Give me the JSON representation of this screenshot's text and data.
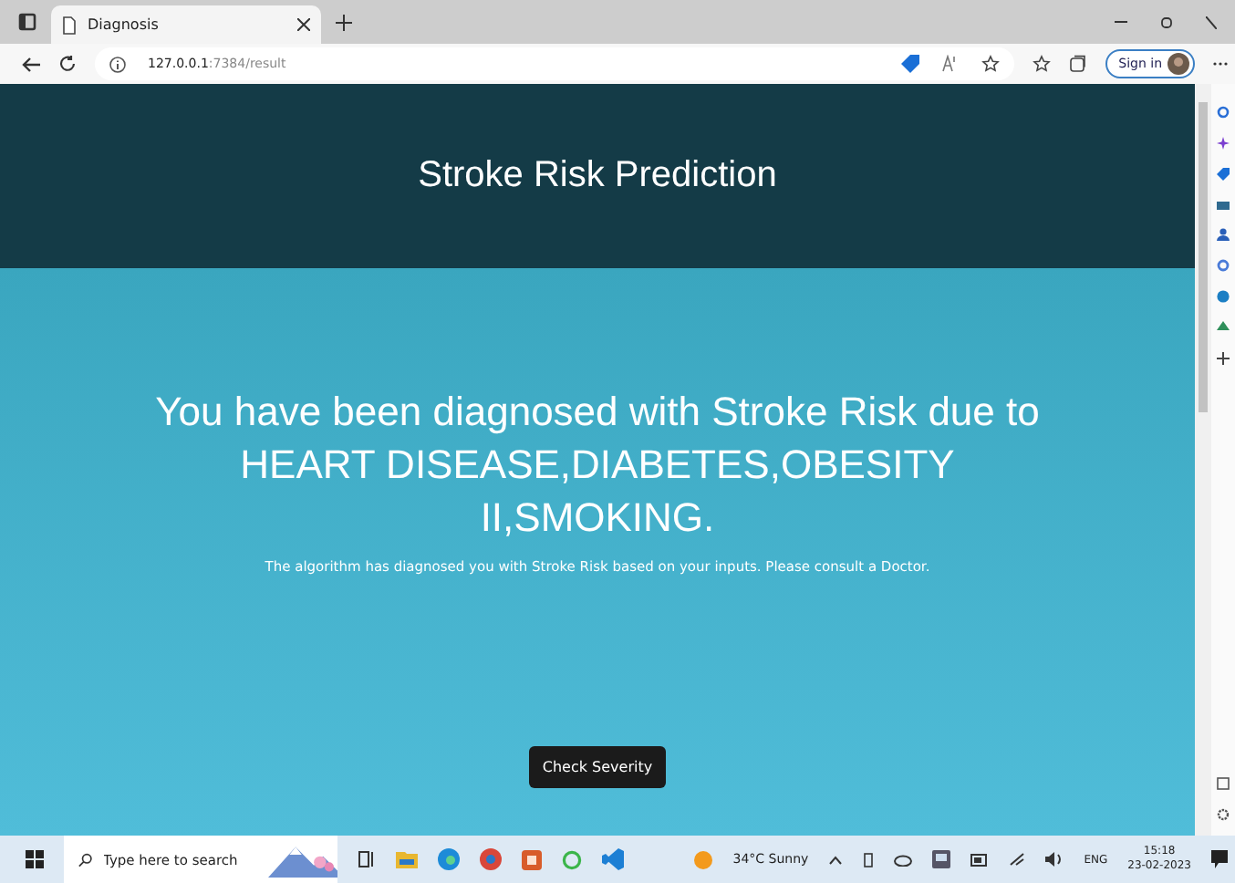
{
  "browser": {
    "tab_title": "Diagnosis",
    "url_host": "127.0.0.1",
    "url_rest": ":7384/result",
    "sign_in": "Sign in"
  },
  "page": {
    "header_title": "Stroke Risk Prediction",
    "heading": "You have been diagnosed with Stroke Risk due to HEART DISEASE,DIABETES,OBESITY II,SMOKING.",
    "message": "The algorithm has diagnosed you with Stroke Risk based on your inputs. Please consult a Doctor.",
    "button": "Check Severity"
  },
  "taskbar": {
    "search": {
      "placeholder": "Type here to search"
    },
    "weather": "34°C  Sunny",
    "language": "ENG",
    "time": "15:18",
    "date": "23-02-2023"
  }
}
